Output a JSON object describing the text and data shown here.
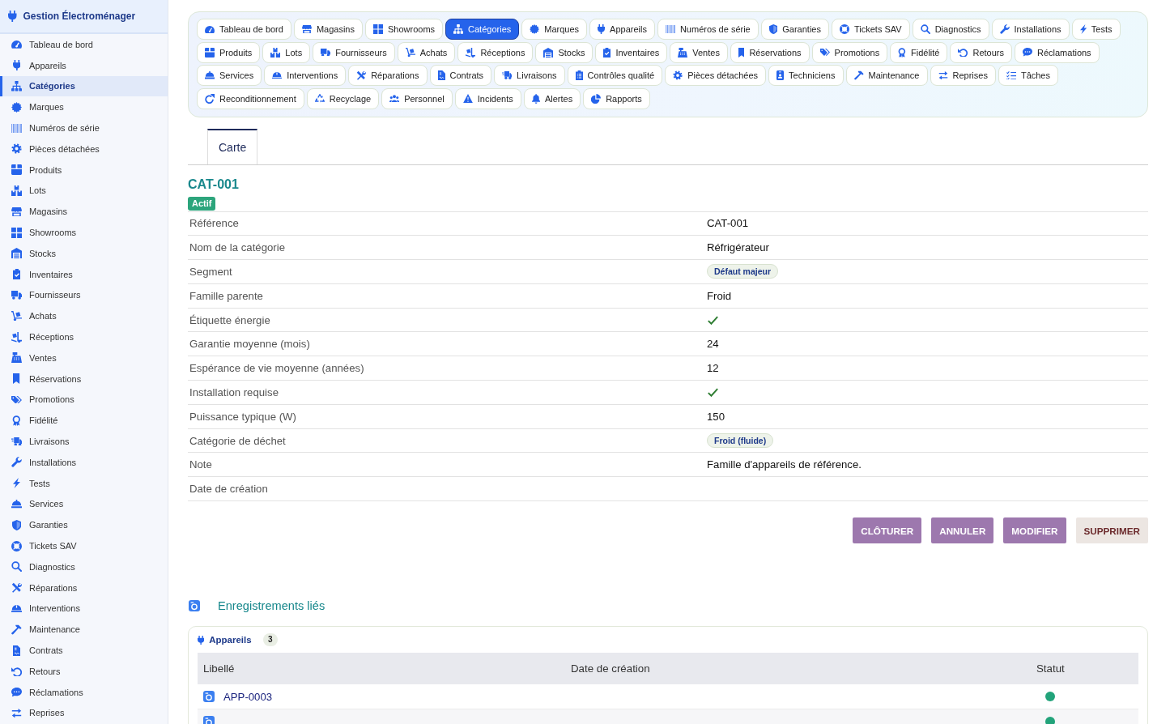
{
  "sidebar": {
    "title": "Gestion Électroménager",
    "items": [
      {
        "label": "Tableau de bord",
        "selected": false
      },
      {
        "label": "Appareils",
        "selected": false
      },
      {
        "label": "Catégories",
        "selected": true
      },
      {
        "label": "Marques",
        "selected": false
      },
      {
        "label": "Numéros de série",
        "selected": false
      },
      {
        "label": "Pièces détachées",
        "selected": false
      },
      {
        "label": "Produits",
        "selected": false
      },
      {
        "label": "Lots",
        "selected": false
      },
      {
        "label": "Magasins",
        "selected": false
      },
      {
        "label": "Showrooms",
        "selected": false
      },
      {
        "label": "Stocks",
        "selected": false
      },
      {
        "label": "Inventaires",
        "selected": false
      },
      {
        "label": "Fournisseurs",
        "selected": false
      },
      {
        "label": "Achats",
        "selected": false
      },
      {
        "label": "Réceptions",
        "selected": false
      },
      {
        "label": "Ventes",
        "selected": false
      },
      {
        "label": "Réservations",
        "selected": false
      },
      {
        "label": "Promotions",
        "selected": false
      },
      {
        "label": "Fidélité",
        "selected": false
      },
      {
        "label": "Livraisons",
        "selected": false
      },
      {
        "label": "Installations",
        "selected": false
      },
      {
        "label": "Tests",
        "selected": false
      },
      {
        "label": "Services",
        "selected": false
      },
      {
        "label": "Garanties",
        "selected": false
      },
      {
        "label": "Tickets SAV",
        "selected": false
      },
      {
        "label": "Diagnostics",
        "selected": false
      },
      {
        "label": "Réparations",
        "selected": false
      },
      {
        "label": "Interventions",
        "selected": false
      },
      {
        "label": "Maintenance",
        "selected": false
      },
      {
        "label": "Contrats",
        "selected": false
      },
      {
        "label": "Retours",
        "selected": false
      },
      {
        "label": "Réclamations",
        "selected": false
      },
      {
        "label": "Reprises",
        "selected": false
      }
    ]
  },
  "nav": {
    "items": [
      {
        "label": "Tableau de bord",
        "selected": false
      },
      {
        "label": "Magasins",
        "selected": false
      },
      {
        "label": "Showrooms",
        "selected": false
      },
      {
        "label": "Catégories",
        "selected": true
      },
      {
        "label": "Marques",
        "selected": false
      },
      {
        "label": "Appareils",
        "selected": false
      },
      {
        "label": "Numéros de série",
        "selected": false
      },
      {
        "label": "Garanties",
        "selected": false
      },
      {
        "label": "Tickets SAV",
        "selected": false
      },
      {
        "label": "Diagnostics",
        "selected": false
      },
      {
        "label": "Installations",
        "selected": false
      },
      {
        "label": "Tests",
        "selected": false
      },
      {
        "label": "Produits",
        "selected": false
      },
      {
        "label": "Lots",
        "selected": false
      },
      {
        "label": "Fournisseurs",
        "selected": false
      },
      {
        "label": "Achats",
        "selected": false
      },
      {
        "label": "Réceptions",
        "selected": false
      },
      {
        "label": "Stocks",
        "selected": false
      },
      {
        "label": "Inventaires",
        "selected": false
      },
      {
        "label": "Ventes",
        "selected": false
      },
      {
        "label": "Réservations",
        "selected": false
      },
      {
        "label": "Promotions",
        "selected": false
      },
      {
        "label": "Fidélité",
        "selected": false
      },
      {
        "label": "Retours",
        "selected": false
      },
      {
        "label": "Réclamations",
        "selected": false
      },
      {
        "label": "Services",
        "selected": false
      },
      {
        "label": "Interventions",
        "selected": false
      },
      {
        "label": "Réparations",
        "selected": false
      },
      {
        "label": "Contrats",
        "selected": false
      },
      {
        "label": "Livraisons",
        "selected": false
      },
      {
        "label": "Contrôles qualité",
        "selected": false
      },
      {
        "label": "Pièces détachées",
        "selected": false
      },
      {
        "label": "Techniciens",
        "selected": false
      },
      {
        "label": "Maintenance",
        "selected": false
      },
      {
        "label": "Reprises",
        "selected": false
      },
      {
        "label": "Tâches",
        "selected": false
      },
      {
        "label": "Reconditionnement",
        "selected": false
      },
      {
        "label": "Recyclage",
        "selected": false
      },
      {
        "label": "Personnel",
        "selected": false
      },
      {
        "label": "Incidents",
        "selected": false
      },
      {
        "label": "Alertes",
        "selected": false
      },
      {
        "label": "Rapports",
        "selected": false
      }
    ]
  },
  "tabs": [
    {
      "label": "Carte",
      "selected": true
    }
  ],
  "record": {
    "title": "CAT-001",
    "status": "Actif",
    "fields": [
      {
        "label": "Référence",
        "kind": "text",
        "value": "CAT-001"
      },
      {
        "label": "Nom de la catégorie",
        "kind": "text",
        "value": "Réfrigérateur"
      },
      {
        "label": "Segment",
        "kind": "badge",
        "value": "Défaut majeur"
      },
      {
        "label": "Famille parente",
        "kind": "text",
        "value": "Froid"
      },
      {
        "label": "Étiquette énergie",
        "kind": "check",
        "checked": true
      },
      {
        "label": "Garantie moyenne (mois)",
        "kind": "text",
        "value": "24"
      },
      {
        "label": "Espérance de vie moyenne (années)",
        "kind": "text",
        "value": "12"
      },
      {
        "label": "Installation requise",
        "kind": "check",
        "checked": true
      },
      {
        "label": "Puissance typique (W)",
        "kind": "text",
        "value": "150"
      },
      {
        "label": "Catégorie de déchet",
        "kind": "badge",
        "value": "Froid (fluide)"
      },
      {
        "label": "Note",
        "kind": "text",
        "value": "Famille d'appareils de référence."
      },
      {
        "label": "Date de création",
        "kind": "text"
      }
    ]
  },
  "actions": [
    {
      "label": "CLÔTURER",
      "kind": "primary"
    },
    {
      "label": "ANNULER",
      "kind": "primary"
    },
    {
      "label": "MODIFIER",
      "kind": "primary"
    },
    {
      "label": "SUPPRIMER",
      "kind": "danger"
    }
  ],
  "related": {
    "title": "Enregistrements liés",
    "sections": [
      {
        "title": "Appareils",
        "count": "3",
        "columns": [
          "Libellé",
          "Date de création",
          "Statut"
        ],
        "rows": [
          {
            "label": "APP-0003",
            "color": "#22a37a"
          },
          {
            "color": "#22a37a"
          }
        ]
      }
    ]
  }
}
